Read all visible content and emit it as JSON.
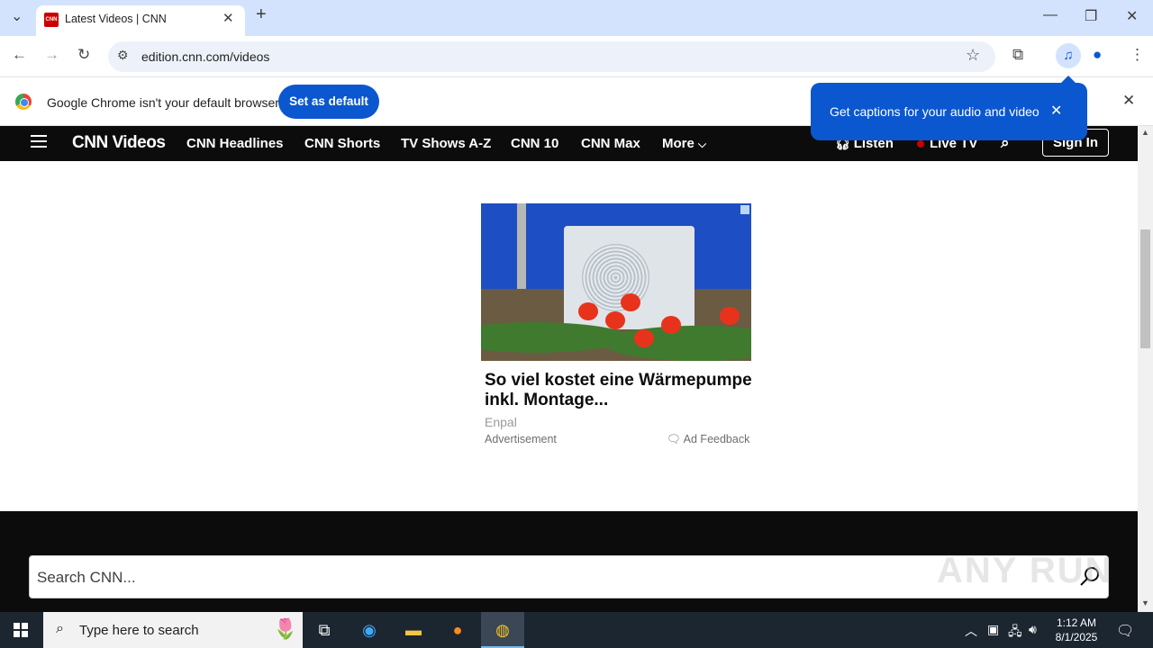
{
  "browser": {
    "tab_title": "Latest Videos | CNN",
    "favicon_text": "CNN",
    "url": "edition.cnn.com/videos",
    "icons": [
      "tab-search-icon",
      "close-icon",
      "new-tab-icon",
      "minimize-icon",
      "restore-icon",
      "back-icon",
      "forward-icon",
      "reload-icon",
      "site-info-icon",
      "bookmark-star-icon",
      "extensions-icon",
      "media-control-icon",
      "profile-icon",
      "menu-icon"
    ]
  },
  "infobar": {
    "message": "Google Chrome isn't your default browser",
    "button": "Set as default"
  },
  "captions_popup": {
    "text": "Get captions for your audio and video"
  },
  "cnn_nav": {
    "logo": "CNN Videos",
    "items": [
      "CNN Headlines",
      "CNN Shorts",
      "TV Shows A-Z",
      "CNN 10",
      "CNN Max",
      "More"
    ],
    "listen": "Listen",
    "live_tv": "Live TV",
    "sign_in": "Sign In"
  },
  "ad": {
    "headline": "So viel kostet eine Wärmepumpe inkl. Montage...",
    "source": "Enpal",
    "label": "Advertisement",
    "feedback": "Ad Feedback"
  },
  "footer": {
    "search_placeholder": "Search CNN..."
  },
  "watermark": "ANY RUN",
  "taskbar": {
    "search_text": "Type here to search",
    "time": "1:12 AM",
    "date": "8/1/2025"
  },
  "colors": {
    "chrome_accent": "#0b57d0",
    "tabstrip": "#d3e3fd",
    "cnn_black": "#0c0c0c",
    "cnn_red": "#cc0000"
  }
}
